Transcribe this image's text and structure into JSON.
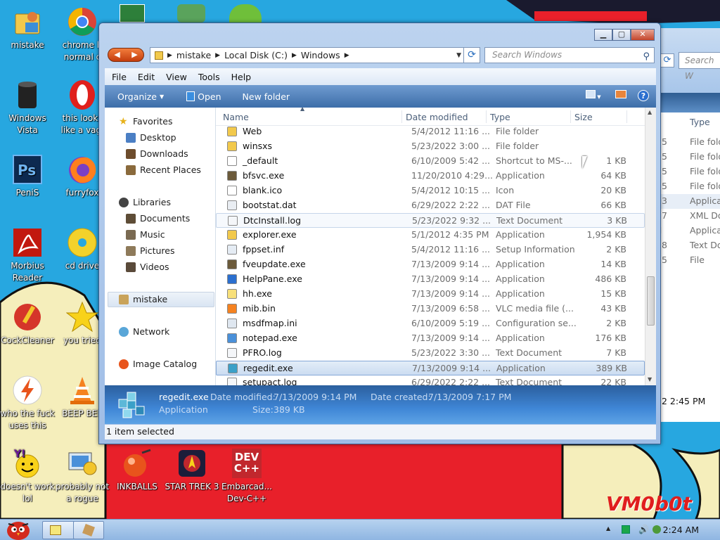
{
  "desktop": {
    "icons": [
      {
        "label": "mistake",
        "icon": "folder-person-icon"
      },
      {
        "label": "chrome b normal c",
        "icon": "chrome-icon"
      },
      {
        "label": "Windows Vista",
        "icon": "trash-can-icon"
      },
      {
        "label": "this looks like a vagi",
        "icon": "opera-icon"
      },
      {
        "label": "PeniS",
        "icon": "photoshop-icon"
      },
      {
        "label": "furryfox",
        "icon": "firefox-icon"
      },
      {
        "label": "Morbius Reader",
        "icon": "acrobat-icon"
      },
      {
        "label": "cd drive",
        "icon": "cd-icon"
      },
      {
        "label": "CockCleaner",
        "icon": "ccleaner-icon"
      },
      {
        "label": "you tried",
        "icon": "star-icon"
      },
      {
        "label": "who the fuck uses this",
        "icon": "lightning-icon"
      },
      {
        "label": "BEEP BEE",
        "icon": "vlc-icon"
      },
      {
        "label": "doesn't work lol",
        "icon": "yahoo-icon"
      },
      {
        "label": "probably not a rogue",
        "icon": "settings-computer-icon"
      },
      {
        "label": "INKBALLS",
        "icon": "inkball-icon"
      },
      {
        "label": "STAR TREK 3",
        "icon": "star-trek-icon"
      },
      {
        "label": "Embarcad... Dev-C++",
        "icon": "devcpp-icon"
      }
    ],
    "devcpp_badge": "DEV C++",
    "brand_text": "VM0b0t"
  },
  "background_window": {
    "search_placeholder": "Search W",
    "header_type": "Type",
    "types": [
      "File fold",
      "File fold",
      "File fold",
      "File fold",
      "Applica",
      "XML Do",
      "Applica",
      "Text Do",
      "File"
    ],
    "numbers": [
      "5",
      "5",
      "5",
      "5",
      "3",
      "7",
      "PM",
      "8",
      "5"
    ],
    "timestamp": "2 2:45 PM"
  },
  "window": {
    "nav_back": "◀",
    "nav_forward": "▶",
    "address": {
      "crumbs": [
        "mistake",
        "Local Disk (C:)",
        "Windows"
      ]
    },
    "search_placeholder": "Search Windows",
    "menu": [
      "File",
      "Edit",
      "View",
      "Tools",
      "Help"
    ],
    "toolbar": {
      "organize": "Organize",
      "open": "Open",
      "new_folder": "New folder"
    },
    "nav_pane": {
      "favorites": "Favorites",
      "desktop": "Desktop",
      "downloads": "Downloads",
      "recent": "Recent Places",
      "libraries": "Libraries",
      "documents": "Documents",
      "music": "Music",
      "pictures": "Pictures",
      "videos": "Videos",
      "user": "mistake",
      "network": "Network",
      "image_catalog": "Image Catalog"
    },
    "columns": {
      "name": "Name",
      "date": "Date modified",
      "type": "Type",
      "size": "Size"
    },
    "files": [
      {
        "name": "Web",
        "date": "5/4/2012 11:16 ...",
        "type": "File folder",
        "size": "",
        "icon": "folder-icon"
      },
      {
        "name": "winsxs",
        "date": "5/23/2022 3:00 ...",
        "type": "File folder",
        "size": "",
        "icon": "folder-icon"
      },
      {
        "name": "_default",
        "date": "6/10/2009 5:42 ...",
        "type": "Shortcut to MS-...",
        "size": "1 KB",
        "icon": "shortcut-icon"
      },
      {
        "name": "bfsvc.exe",
        "date": "11/20/2010 4:29...",
        "type": "Application",
        "size": "64 KB",
        "icon": "exe-icon"
      },
      {
        "name": "blank.ico",
        "date": "5/4/2012 10:15 ...",
        "type": "Icon",
        "size": "20 KB",
        "icon": "ico-icon"
      },
      {
        "name": "bootstat.dat",
        "date": "6/29/2022 2:22 ...",
        "type": "DAT File",
        "size": "66 KB",
        "icon": "dat-file-icon"
      },
      {
        "name": "DtcInstall.log",
        "date": "5/23/2022 9:32 ...",
        "type": "Text Document",
        "size": "3 KB",
        "icon": "text-doc-icon"
      },
      {
        "name": "explorer.exe",
        "date": "5/1/2012 4:35 PM",
        "type": "Application",
        "size": "1,954 KB",
        "icon": "explorer-icon"
      },
      {
        "name": "fppset.inf",
        "date": "5/4/2012 11:16 ...",
        "type": "Setup Information",
        "size": "2 KB",
        "icon": "inf-icon"
      },
      {
        "name": "fveupdate.exe",
        "date": "7/13/2009 9:14 ...",
        "type": "Application",
        "size": "14 KB",
        "icon": "exe-icon"
      },
      {
        "name": "HelpPane.exe",
        "date": "7/13/2009 9:14 ...",
        "type": "Application",
        "size": "486 KB",
        "icon": "help-icon"
      },
      {
        "name": "hh.exe",
        "date": "7/13/2009 9:14 ...",
        "type": "Application",
        "size": "15 KB",
        "icon": "hh-icon"
      },
      {
        "name": "mib.bin",
        "date": "7/13/2009 6:58 ...",
        "type": "VLC media file (...",
        "size": "43 KB",
        "icon": "vlc-file-icon"
      },
      {
        "name": "msdfmap.ini",
        "date": "6/10/2009 5:19 ...",
        "type": "Configuration se...",
        "size": "2 KB",
        "icon": "ini-icon"
      },
      {
        "name": "notepad.exe",
        "date": "7/13/2009 9:14 ...",
        "type": "Application",
        "size": "176 KB",
        "icon": "notepad-icon"
      },
      {
        "name": "PFRO.log",
        "date": "5/23/2022 3:30 ...",
        "type": "Text Document",
        "size": "7 KB",
        "icon": "text-doc-icon"
      },
      {
        "name": "regedit.exe",
        "date": "7/13/2009 9:14 ...",
        "type": "Application",
        "size": "389 KB",
        "icon": "regedit-icon"
      },
      {
        "name": "setupact.log",
        "date": "6/29/2022 2:22 ...",
        "type": "Text Document",
        "size": "22 KB",
        "icon": "text-doc-icon"
      }
    ],
    "details": {
      "name": "regedit.exe",
      "type": "Application",
      "modified_label": "Date modified:",
      "modified": "7/13/2009 9:14 PM",
      "size_label": "Size:",
      "size": "389 KB",
      "created_label": "Date created:",
      "created": "7/13/2009 7:17 PM"
    },
    "status": "1 item selected"
  },
  "taskbar": {
    "clock": "2:24 AM"
  },
  "colors": {
    "desktop_blue": "#27a7e0",
    "red_panel": "#e8202a",
    "selection": "#cbdcf1"
  }
}
